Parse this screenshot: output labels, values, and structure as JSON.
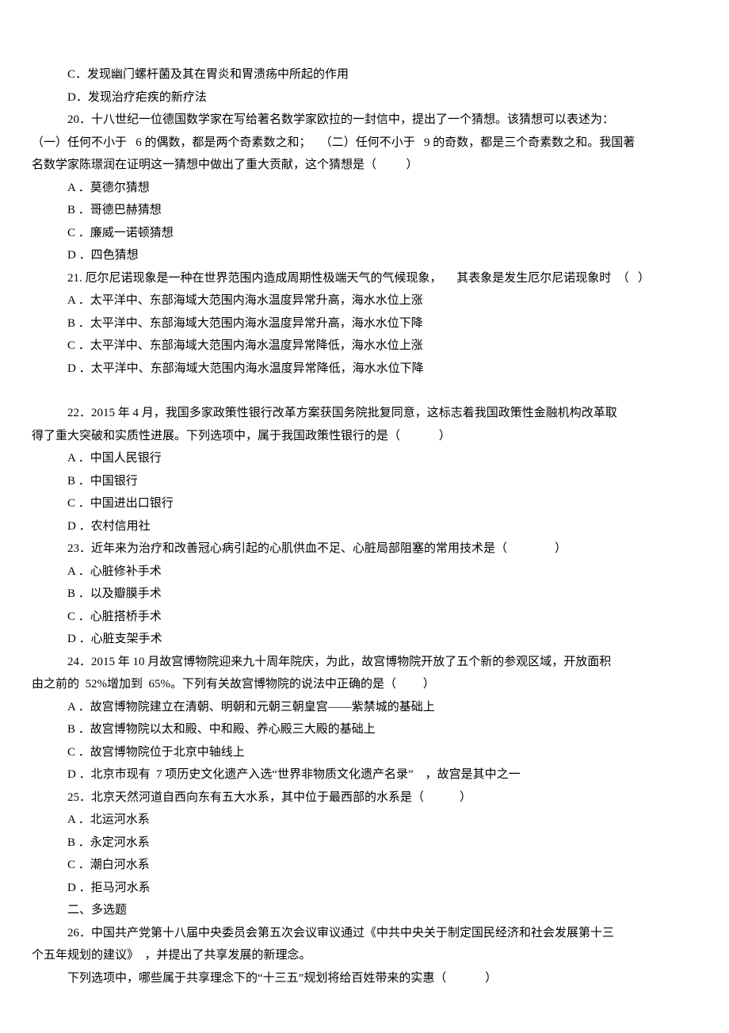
{
  "lines": [
    {
      "cls": "indent-1",
      "text": "C．发现幽门螺杆菌及其在胃炎和胃溃疡中所起的作用"
    },
    {
      "cls": "indent-1",
      "text": "D．发现治疗疟疾的新疗法"
    },
    {
      "cls": "indent-1",
      "text": "20．十八世纪一位德国数学家在写给著名数学家欧拉的一封信中，提出了一个猜想。该猜想可以表述为："
    },
    {
      "cls": "indent-0",
      "text": "（一）任何不小于   6 的偶数，都是两个奇素数之和；   （二）任何不小于   9 的奇数，都是三个奇素数之和。我国著"
    },
    {
      "cls": "indent-0",
      "text": "名数学家陈璟润在证明这一猜想中做出了重大贡献，这个猜想是（          ）"
    },
    {
      "cls": "indent-1",
      "text": "A ．莫德尔猜想"
    },
    {
      "cls": "indent-1",
      "text": "B ．哥德巴赫猜想"
    },
    {
      "cls": "indent-1",
      "text": "C ．廉威一诺顿猜想"
    },
    {
      "cls": "indent-1",
      "text": "D ．四色猜想"
    },
    {
      "cls": "indent-1",
      "text": "21. 厄尔尼诺现象是一种在世界范围内造成周期性极端天气的气候现象，     其表象是发生厄尔尼诺现象时  （   ）"
    },
    {
      "cls": "indent-1",
      "text": "A ．太平洋中、东部海域大范围内海水温度异常升高，海水水位上涨"
    },
    {
      "cls": "indent-1",
      "text": "B ．太平洋中、东部海域大范围内海水温度异常升高，海水水位下降"
    },
    {
      "cls": "indent-1",
      "text": "C ．太平洋中、东部海域大范围内海水温度异常降低，海水水位上涨"
    },
    {
      "cls": "indent-1",
      "text": "D ．太平洋中、东部海域大范围内海水温度异常降低，海水水位下降"
    },
    {
      "cls": "spacer",
      "text": ""
    },
    {
      "cls": "indent-1",
      "text": "22．2015 年 4 月，我国多家政策性银行改革方案获国务院批复同意，这标志着我国政策性金融机构改革取"
    },
    {
      "cls": "indent-0",
      "text": "得了重大突破和实质性进展。下列选项中，属于我国政策性银行的是（             ）"
    },
    {
      "cls": "indent-1",
      "text": "A ．中国人民银行"
    },
    {
      "cls": "indent-1",
      "text": "B ．中国银行"
    },
    {
      "cls": "indent-1",
      "text": "C ．中国进出口银行"
    },
    {
      "cls": "indent-1",
      "text": "D ．农村信用社"
    },
    {
      "cls": "indent-1",
      "text": "23．近年来为治疗和改善冠心病引起的心肌供血不足、心脏局部阻塞的常用技术是（                ）"
    },
    {
      "cls": "indent-1",
      "text": "A ．心脏修补手术"
    },
    {
      "cls": "indent-1",
      "text": "B ．以及瓣膜手术"
    },
    {
      "cls": "indent-1",
      "text": "C ．心脏搭桥手术"
    },
    {
      "cls": "indent-1",
      "text": "D ．心脏支架手术"
    },
    {
      "cls": "indent-1",
      "text": "24．2015 年 10 月故宫博物院迎来九十周年院庆，为此，故宫博物院开放了五个新的参观区域，开放面积"
    },
    {
      "cls": "indent-0",
      "text": "由之前的  52%增加到  65%。下列有关故宫博物院的说法中正确的是（         ）"
    },
    {
      "cls": "indent-1",
      "text": "A ．故宫博物院建立在清朝、明朝和元朝三朝皇宫——紫禁城的基础上"
    },
    {
      "cls": "indent-1",
      "text": "B ．故宫博物院以太和殿、中和殿、养心殿三大殿的基础上"
    },
    {
      "cls": "indent-1",
      "text": "C ．故宫博物院位于北京中轴线上"
    },
    {
      "cls": "indent-1",
      "text": "D ．北京市现有  7 项历史文化遗产入选“世界非物质文化遗产名录”    ，故宫是其中之一"
    },
    {
      "cls": "indent-1",
      "text": "25．北京天然河道自西向东有五大水系，其中位于最西部的水系是（            ）"
    },
    {
      "cls": "indent-1",
      "text": "A ．北运河水系"
    },
    {
      "cls": "indent-1",
      "text": "B ．永定河水系"
    },
    {
      "cls": "indent-1",
      "text": "C ．潮白河水系"
    },
    {
      "cls": "indent-1",
      "text": "D ．拒马河水系"
    },
    {
      "cls": "indent-1",
      "text": "二、多选题"
    },
    {
      "cls": "indent-1",
      "text": "26．中国共产党第十八届中央委员会第五次会议审议通过《中共中央关于制定国民经济和社会发展第十三"
    },
    {
      "cls": "indent-0",
      "text": "个五年规划的建议》  ，并提出了共享发展的新理念。"
    },
    {
      "cls": "indent-1",
      "text": "下列选项中，哪些属于共享理念下的“十三五”规划将给百姓带来的实惠（             ）"
    }
  ]
}
